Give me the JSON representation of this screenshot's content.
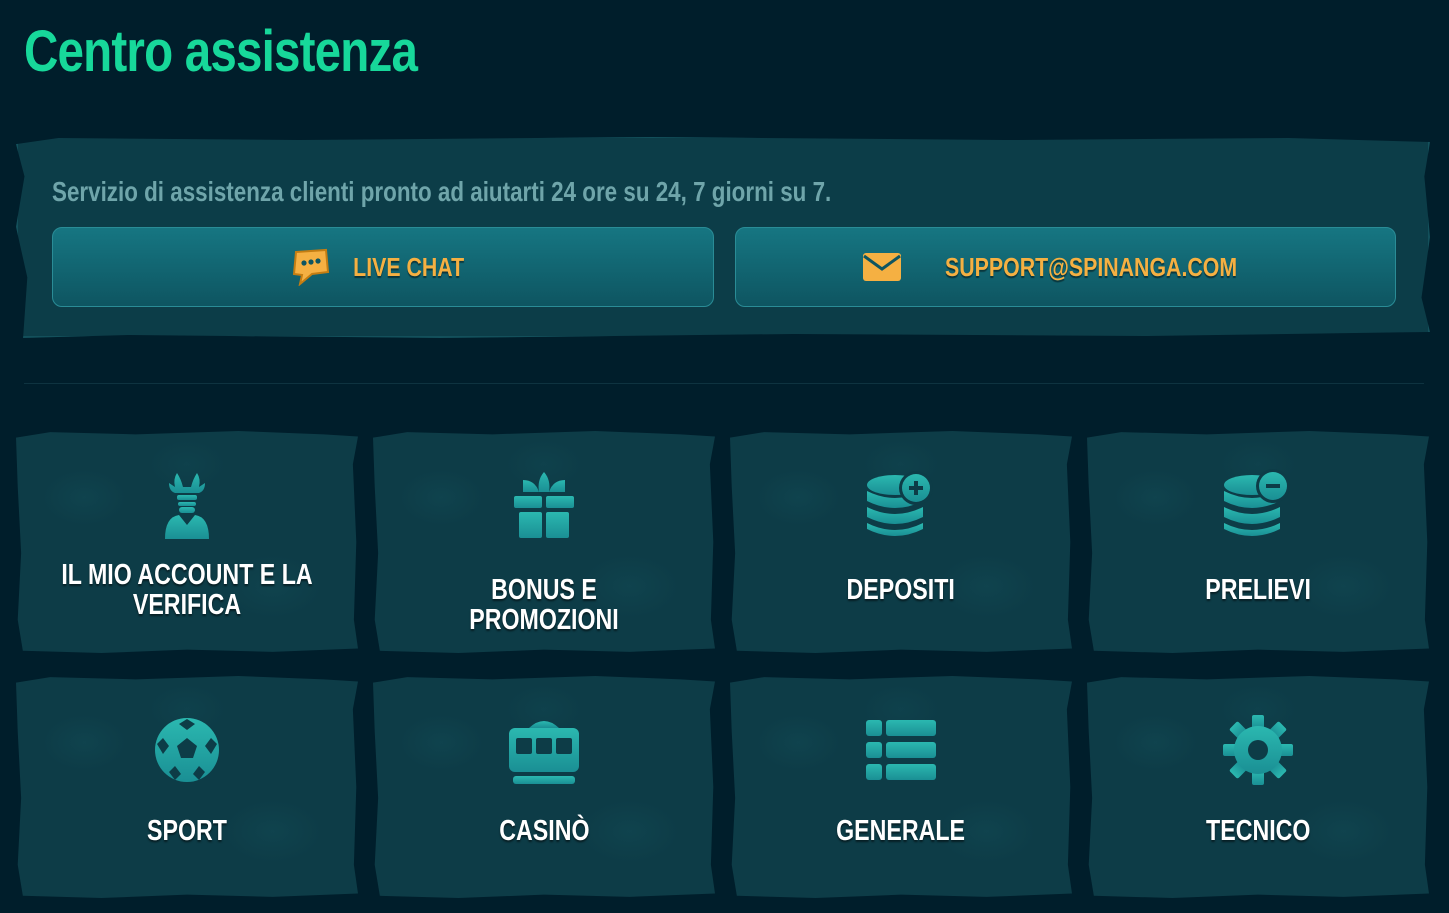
{
  "page": {
    "title": "Centro assistenza"
  },
  "support": {
    "description": "Servizio di assistenza clienti pronto ad aiutarti 24 ore su 24, 7 giorni su 7.",
    "live_chat_label": "LIVE CHAT",
    "email_label": "SUPPORT@SPINANGA.COM"
  },
  "categories": [
    {
      "label": "IL MIO ACCOUNT E LA VERIFICA",
      "icon": "account-icon"
    },
    {
      "label": "BONUS E PROMOZIONI",
      "icon": "gift-icon"
    },
    {
      "label": "DEPOSITI",
      "icon": "coins-plus-icon"
    },
    {
      "label": "PRELIEVI",
      "icon": "coins-minus-icon"
    },
    {
      "label": "SPORT",
      "icon": "soccer-ball-icon"
    },
    {
      "label": "CASINÒ",
      "icon": "slot-machine-icon"
    },
    {
      "label": "GENERALE",
      "icon": "list-icon"
    },
    {
      "label": "TECNICO",
      "icon": "gear-icon"
    }
  ],
  "colors": {
    "background": "#001e2b",
    "title": "#17d89a",
    "accent": "#f5b042",
    "icon": "#1fa5a2",
    "panel": "#0c3d48"
  }
}
